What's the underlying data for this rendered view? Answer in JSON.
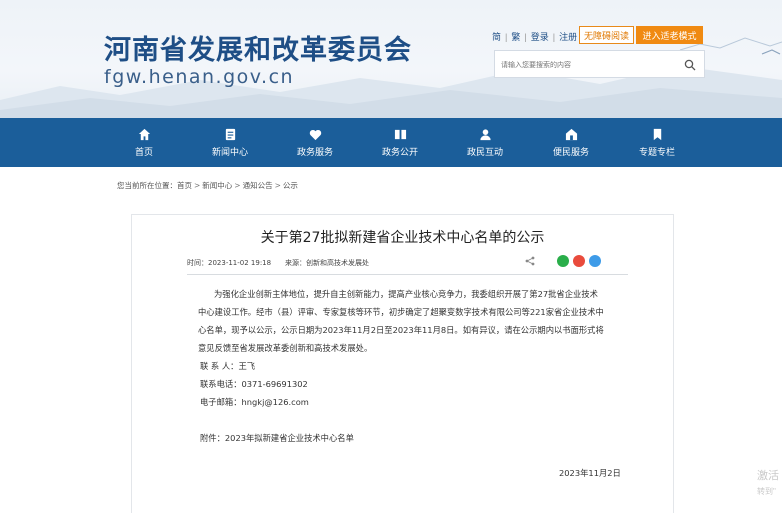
{
  "header": {
    "site_title": "河南省发展和改革委员会",
    "site_url": "fgw.henan.gov.cn",
    "top_links": [
      "简",
      "繁",
      "登录",
      "注册"
    ],
    "barrier_free_label": "无障碍阅读",
    "elder_mode_label": "进入适老模式",
    "search_placeholder": "请输入您要搜索的内容"
  },
  "nav": {
    "items": [
      {
        "label": "首页",
        "icon": "home-icon"
      },
      {
        "label": "新闻中心",
        "icon": "news-icon"
      },
      {
        "label": "政务服务",
        "icon": "service-icon"
      },
      {
        "label": "政务公开",
        "icon": "book-icon"
      },
      {
        "label": "政民互动",
        "icon": "user-icon"
      },
      {
        "label": "便民服务",
        "icon": "house-icon"
      },
      {
        "label": "专题专栏",
        "icon": "bookmark-icon"
      }
    ],
    "bg_color": "#1b5e9a"
  },
  "breadcrumb": {
    "prefix": "您当前所在位置：",
    "items": [
      "首页",
      "新闻中心",
      "通知公告",
      "公示"
    ]
  },
  "article": {
    "title": "关于第27批拟新建省企业技术中心名单的公示",
    "time_label": "时间：",
    "time": "2023-11-02 19:18",
    "source_label": "来源：",
    "source": "创新和高技术发展处",
    "paragraph_lines": [
      "为强化企业创新主体地位，提升自主创新能力，提高产业核心竞争力，我委组织开展了第27批省企业技术",
      "中心建设工作。经市（县）评审、专家复核等环节，初步确定了超聚变数字技术有限公司等221家省企业技术中",
      "心名单，现予以公示，公示日期为2023年11月2日至2023年11月8日。如有异议，请在公示期内以书面形式将",
      "意见反馈至省发展改革委创新和高技术发展处。"
    ],
    "contact_person": "联 系 人：王飞",
    "contact_phone": "联系电话：0371-69691302",
    "contact_email": "电子邮箱：hngkj@126.com",
    "attachment": "附件：2023年拟新建省企业技术中心名单",
    "sign_date": "2023年11月2日"
  },
  "watermark": {
    "line1": "激活",
    "line2": "转到\""
  }
}
